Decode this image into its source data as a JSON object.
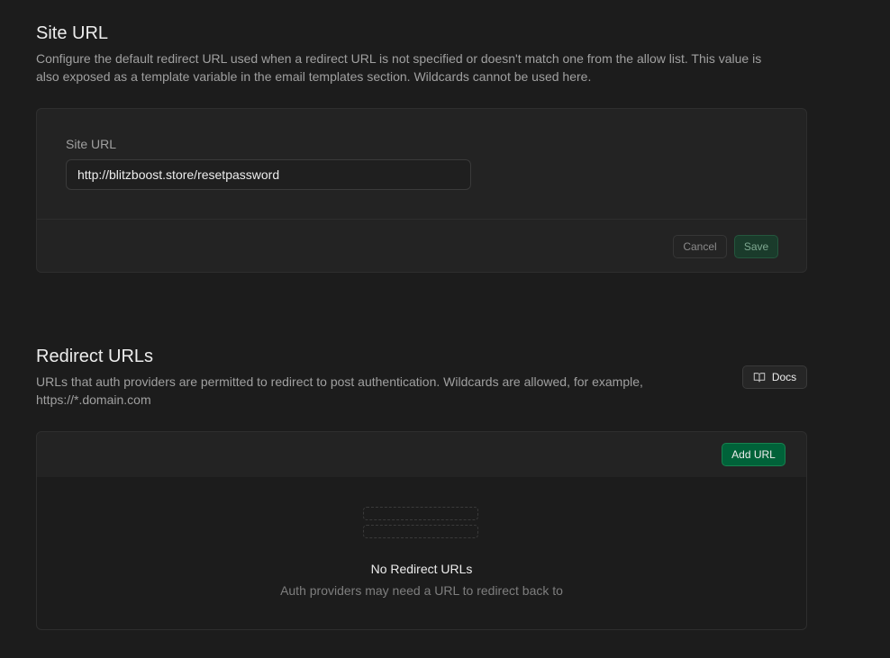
{
  "site_url": {
    "title": "Site URL",
    "description": "Configure the default redirect URL used when a redirect URL is not specified or doesn't match one from the allow list. This value is also exposed as a template variable in the email templates section. Wildcards cannot be used here.",
    "field_label": "Site URL",
    "field_value": "http://blitzboost.store/resetpassword",
    "cancel_label": "Cancel",
    "save_label": "Save"
  },
  "redirect_urls": {
    "title": "Redirect URLs",
    "description": "URLs that auth providers are permitted to redirect to post authentication. Wildcards are allowed, for example, https://*.domain.com",
    "docs_label": "Docs",
    "docs_icon": "book-open-icon",
    "add_label": "Add URL",
    "empty_title": "No Redirect URLs",
    "empty_description": "Auth providers may need a URL to redirect back to"
  },
  "colors": {
    "background": "#1c1c1c",
    "card": "#232323",
    "accent": "#006239"
  }
}
